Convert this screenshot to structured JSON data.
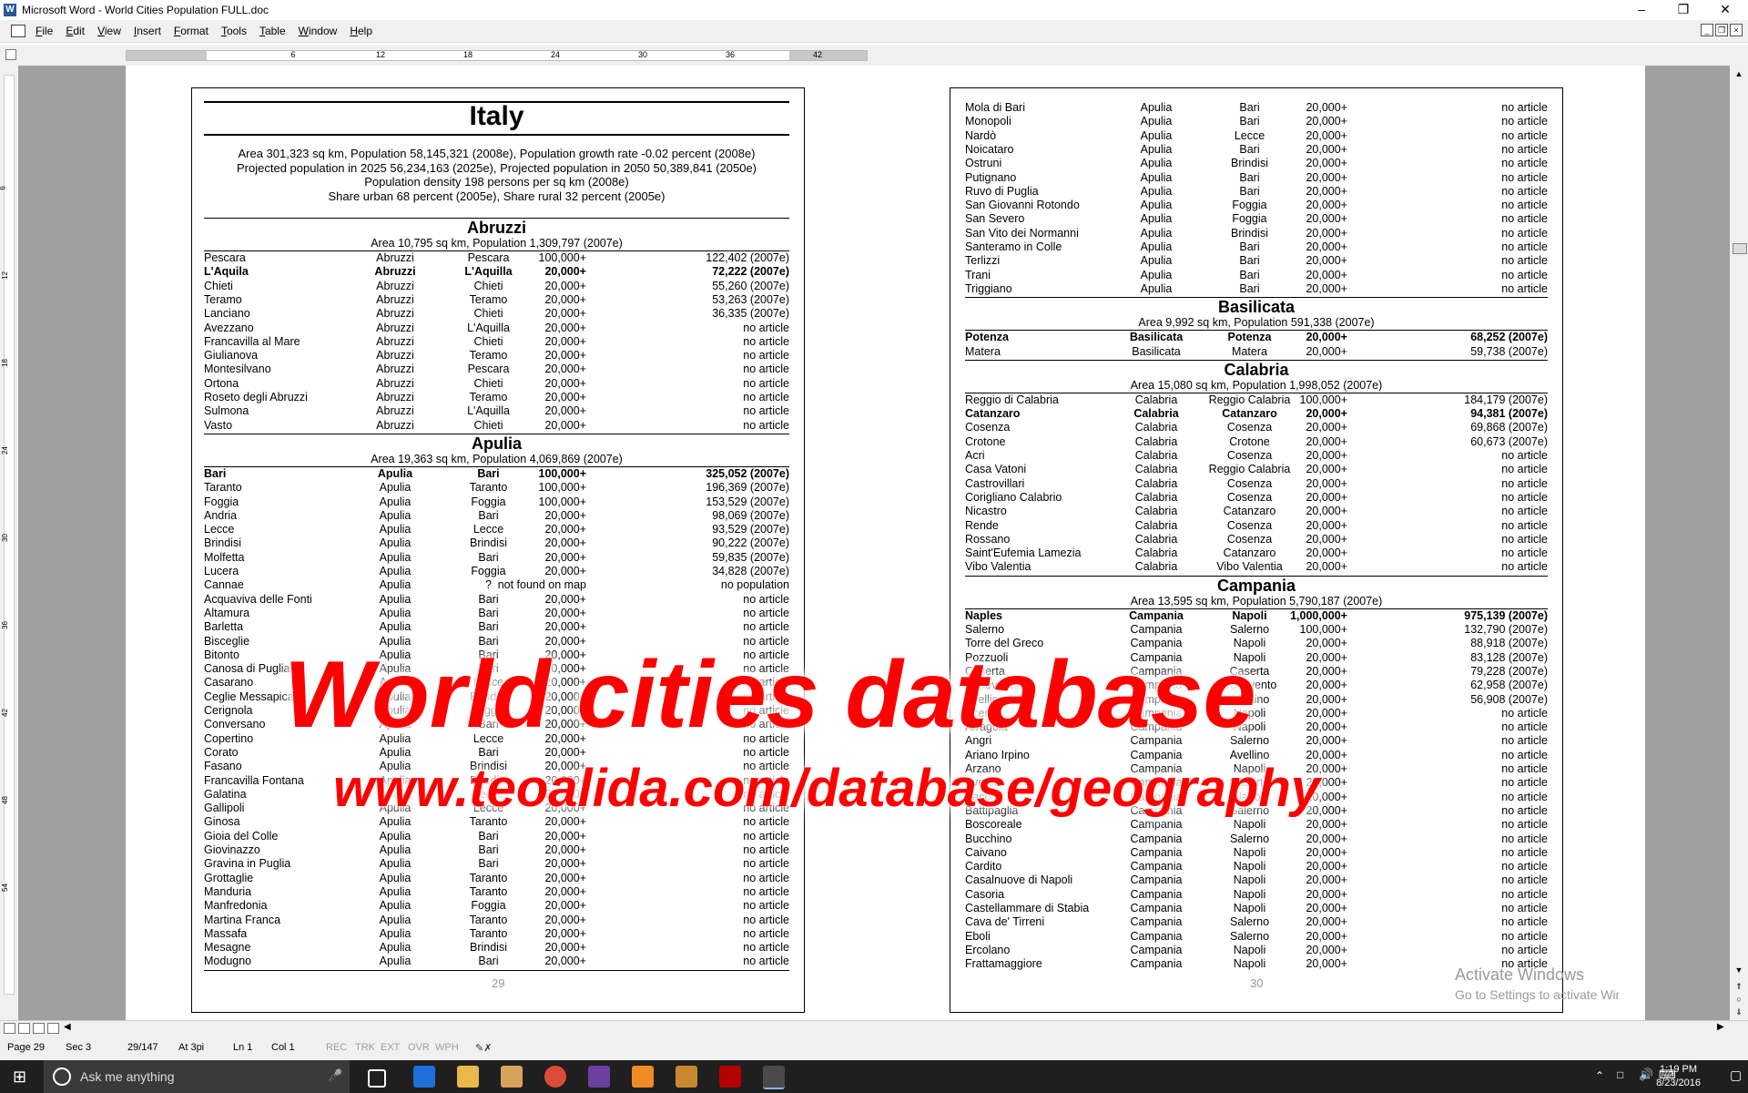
{
  "window": {
    "title": "Microsoft Word - World Cities Population FULL.doc"
  },
  "menu": [
    "File",
    "Edit",
    "View",
    "Insert",
    "Format",
    "Tools",
    "Table",
    "Window",
    "Help"
  ],
  "ruler": {
    "h_numbers": [
      "6",
      "12",
      "18",
      "24",
      "30",
      "36",
      "42"
    ],
    "v_numbers": [
      "6",
      "12",
      "18",
      "24",
      "30",
      "36",
      "42",
      "48",
      "54"
    ]
  },
  "left_page": {
    "country": "Italy",
    "intro": [
      "Area 301,323 sq km, Population 58,145,321 (2008e), Population growth rate -0.02 percent (2008e)",
      "Projected population in 2025 56,234,163 (2025e), Projected population in 2050 50,389,841 (2050e)",
      "Population density 198 persons per sq km (2008e)",
      "Share urban 68 percent (2005e), Share rural 32 percent (2005e)"
    ],
    "sections": [
      {
        "name": "Abruzzi",
        "subtitle": "Area 10,795 sq km, Population 1,309,797 (2007e)",
        "rows": [
          [
            "Pescara",
            "Abruzzi",
            "Pescara",
            "100,000+",
            "122,402 (2007e)",
            0
          ],
          [
            "L'Aquila",
            "Abruzzi",
            "L'Aquilla",
            "20,000+",
            "72,222 (2007e)",
            1
          ],
          [
            "Chieti",
            "Abruzzi",
            "Chieti",
            "20,000+",
            "55,260 (2007e)",
            0
          ],
          [
            "Teramo",
            "Abruzzi",
            "Teramo",
            "20,000+",
            "53,263 (2007e)",
            0
          ],
          [
            "Lanciano",
            "Abruzzi",
            "Chieti",
            "20,000+",
            "36,335 (2007e)",
            0
          ],
          [
            "Avezzano",
            "Abruzzi",
            "L'Aquilla",
            "20,000+",
            "no article",
            0
          ],
          [
            "Francavilla al Mare",
            "Abruzzi",
            "Chieti",
            "20,000+",
            "no article",
            0
          ],
          [
            "Giulianova",
            "Abruzzi",
            "Teramo",
            "20,000+",
            "no article",
            0
          ],
          [
            "Montesilvano",
            "Abruzzi",
            "Pescara",
            "20,000+",
            "no article",
            0
          ],
          [
            "Ortona",
            "Abruzzi",
            "Chieti",
            "20,000+",
            "no article",
            0
          ],
          [
            "Roseto degli Abruzzi",
            "Abruzzi",
            "Teramo",
            "20,000+",
            "no article",
            0
          ],
          [
            "Sulmona",
            "Abruzzi",
            "L'Aquilla",
            "20,000+",
            "no article",
            0
          ],
          [
            "Vasto",
            "Abruzzi",
            "Chieti",
            "20,000+",
            "no article",
            0
          ]
        ]
      },
      {
        "name": "Apulia",
        "subtitle": "Area 19,363 sq km, Population 4,069,869 (2007e)",
        "rows": [
          [
            "Bari",
            "Apulia",
            "Bari",
            "100,000+",
            "325,052 (2007e)",
            1
          ],
          [
            "Taranto",
            "Apulia",
            "Taranto",
            "100,000+",
            "196,369 (2007e)",
            0
          ],
          [
            "Foggia",
            "Apulia",
            "Foggia",
            "100,000+",
            "153,529 (2007e)",
            0
          ],
          [
            "Andria",
            "Apulia",
            "Bari",
            "20,000+",
            "98,069 (2007e)",
            0
          ],
          [
            "Lecce",
            "Apulia",
            "Lecce",
            "20,000+",
            "93,529 (2007e)",
            0
          ],
          [
            "Brindisi",
            "Apulia",
            "Brindisi",
            "20,000+",
            "90,222 (2007e)",
            0
          ],
          [
            "Molfetta",
            "Apulia",
            "Bari",
            "20,000+",
            "59,835 (2007e)",
            0
          ],
          [
            "Lucera",
            "Apulia",
            "Foggia",
            "20,000+",
            "34,828 (2007e)",
            0
          ],
          [
            "Cannae",
            "Apulia",
            "?",
            "not found on map",
            "no population",
            0
          ],
          [
            "Acquaviva delle Fonti",
            "Apulia",
            "Bari",
            "20,000+",
            "no article",
            0
          ],
          [
            "Altamura",
            "Apulia",
            "Bari",
            "20,000+",
            "no article",
            0
          ],
          [
            "Barletta",
            "Apulia",
            "Bari",
            "20,000+",
            "no article",
            0
          ],
          [
            "Bisceglie",
            "Apulia",
            "Bari",
            "20,000+",
            "no article",
            0
          ],
          [
            "Bitonto",
            "Apulia",
            "Bari",
            "20,000+",
            "no article",
            0
          ],
          [
            "Canosa di Puglia",
            "Apulia",
            "Bari",
            "20,000+",
            "no article",
            0
          ],
          [
            "Casarano",
            "Apulia",
            "Lecce",
            "20,000+",
            "no article",
            0
          ],
          [
            "Ceglie Messapica",
            "Apulia",
            "Brindisi",
            "20,000+",
            "no article",
            0
          ],
          [
            "Cerignola",
            "Apulia",
            "Foggia",
            "20,000+",
            "no article",
            0
          ],
          [
            "Conversano",
            "Apulia",
            "Bari",
            "20,000+",
            "no article",
            0
          ],
          [
            "Copertino",
            "Apulia",
            "Lecce",
            "20,000+",
            "no article",
            0
          ],
          [
            "Corato",
            "Apulia",
            "Bari",
            "20,000+",
            "no article",
            0
          ],
          [
            "Fasano",
            "Apulia",
            "Brindisi",
            "20,000+",
            "no article",
            0
          ],
          [
            "Francavilla Fontana",
            "Apulia",
            "Brindisi",
            "20,000+",
            "no article",
            0
          ],
          [
            "Galatina",
            "Apulia",
            "Lecce",
            "20,000+",
            "no article",
            0
          ],
          [
            "Gallipoli",
            "Apulia",
            "Lecce",
            "20,000+",
            "no article",
            0
          ],
          [
            "Ginosa",
            "Apulia",
            "Taranto",
            "20,000+",
            "no article",
            0
          ],
          [
            "Gioia del Colle",
            "Apulia",
            "Bari",
            "20,000+",
            "no article",
            0
          ],
          [
            "Giovinazzo",
            "Apulia",
            "Bari",
            "20,000+",
            "no article",
            0
          ],
          [
            "Gravina in Puglia",
            "Apulia",
            "Bari",
            "20,000+",
            "no article",
            0
          ],
          [
            "Grottaglie",
            "Apulia",
            "Taranto",
            "20,000+",
            "no article",
            0
          ],
          [
            "Manduria",
            "Apulia",
            "Taranto",
            "20,000+",
            "no article",
            0
          ],
          [
            "Manfredonia",
            "Apulia",
            "Foggia",
            "20,000+",
            "no article",
            0
          ],
          [
            "Martina Franca",
            "Apulia",
            "Taranto",
            "20,000+",
            "no article",
            0
          ],
          [
            "Massafa",
            "Apulia",
            "Taranto",
            "20,000+",
            "no article",
            0
          ],
          [
            "Mesagne",
            "Apulia",
            "Brindisi",
            "20,000+",
            "no article",
            0
          ],
          [
            "Modugno",
            "Apulia",
            "Bari",
            "20,000+",
            "no article",
            0
          ]
        ]
      }
    ],
    "page_number": "29"
  },
  "right_page": {
    "sections": [
      {
        "name": "",
        "subtitle": "",
        "rows": [
          [
            "Mola di Bari",
            "Apulia",
            "Bari",
            "20,000+",
            "no article",
            0
          ],
          [
            "Monopoli",
            "Apulia",
            "Bari",
            "20,000+",
            "no article",
            0
          ],
          [
            "Nardò",
            "Apulia",
            "Lecce",
            "20,000+",
            "no article",
            0
          ],
          [
            "Noicataro",
            "Apulia",
            "Bari",
            "20,000+",
            "no article",
            0
          ],
          [
            "Ostruni",
            "Apulia",
            "Brindisi",
            "20,000+",
            "no article",
            0
          ],
          [
            "Putignano",
            "Apulia",
            "Bari",
            "20,000+",
            "no article",
            0
          ],
          [
            "Ruvo di Puglia",
            "Apulia",
            "Bari",
            "20,000+",
            "no article",
            0
          ],
          [
            "San Giovanni Rotondo",
            "Apulia",
            "Foggia",
            "20,000+",
            "no article",
            0
          ],
          [
            "San Severo",
            "Apulia",
            "Foggia",
            "20,000+",
            "no article",
            0
          ],
          [
            "San Vito dei Normanni",
            "Apulia",
            "Brindisi",
            "20,000+",
            "no article",
            0
          ],
          [
            "Santeramo in Colle",
            "Apulia",
            "Bari",
            "20,000+",
            "no article",
            0
          ],
          [
            "Terlizzi",
            "Apulia",
            "Bari",
            "20,000+",
            "no article",
            0
          ],
          [
            "Trani",
            "Apulia",
            "Bari",
            "20,000+",
            "no article",
            0
          ],
          [
            "Triggiano",
            "Apulia",
            "Bari",
            "20,000+",
            "no article",
            0
          ]
        ]
      },
      {
        "name": "Basilicata",
        "subtitle": "Area 9,992 sq km, Population 591,338 (2007e)",
        "rows": [
          [
            "Potenza",
            "Basilicata",
            "Potenza",
            "20,000+",
            "68,252 (2007e)",
            1
          ],
          [
            "Matera",
            "Basilicata",
            "Matera",
            "20,000+",
            "59,738 (2007e)",
            0
          ]
        ]
      },
      {
        "name": "Calabria",
        "subtitle": "Area 15,080 sq km, Population 1,998,052 (2007e)",
        "rows": [
          [
            "Reggio di Calabria",
            "Calabria",
            "Reggio Calabria",
            "100,000+",
            "184,179 (2007e)",
            0
          ],
          [
            "Catanzaro",
            "Calabria",
            "Catanzaro",
            "20,000+",
            "94,381 (2007e)",
            1
          ],
          [
            "Cosenza",
            "Calabria",
            "Cosenza",
            "20,000+",
            "69,868 (2007e)",
            0
          ],
          [
            "Crotone",
            "Calabria",
            "Crotone",
            "20,000+",
            "60,673 (2007e)",
            0
          ],
          [
            "Acri",
            "Calabria",
            "Cosenza",
            "20,000+",
            "no article",
            0
          ],
          [
            "Casa Vatoni",
            "Calabria",
            "Reggio Calabria",
            "20,000+",
            "no article",
            0
          ],
          [
            "Castrovillari",
            "Calabria",
            "Cosenza",
            "20,000+",
            "no article",
            0
          ],
          [
            "Corigliano Calabrio",
            "Calabria",
            "Cosenza",
            "20,000+",
            "no article",
            0
          ],
          [
            "Nicastro",
            "Calabria",
            "Catanzaro",
            "20,000+",
            "no article",
            0
          ],
          [
            "Rende",
            "Calabria",
            "Cosenza",
            "20,000+",
            "no article",
            0
          ],
          [
            "Rossano",
            "Calabria",
            "Cosenza",
            "20,000+",
            "no article",
            0
          ],
          [
            "Saint'Eufemia Lamezia",
            "Calabria",
            "Catanzaro",
            "20,000+",
            "no article",
            0
          ],
          [
            "Vibo Valentia",
            "Calabria",
            "Vibo Valentia",
            "20,000+",
            "no article",
            0
          ]
        ]
      },
      {
        "name": "Campania",
        "subtitle": "Area 13,595 sq km, Population 5,790,187 (2007e)",
        "rows": [
          [
            "Naples",
            "Campania",
            "Napoli",
            "1,000,000+",
            "975,139 (2007e)",
            1
          ],
          [
            "Salerno",
            "Campania",
            "Salerno",
            "100,000+",
            "132,790 (2007e)",
            0
          ],
          [
            "Torre del Greco",
            "Campania",
            "Napoli",
            "20,000+",
            "88,918 (2007e)",
            0
          ],
          [
            "Pozzuoli",
            "Campania",
            "Napoli",
            "20,000+",
            "83,128 (2007e)",
            0
          ],
          [
            "Caserta",
            "Campania",
            "Caserta",
            "20,000+",
            "79,228 (2007e)",
            0
          ],
          [
            "Benevento",
            "Campania",
            "Benevento",
            "20,000+",
            "62,958 (2007e)",
            0
          ],
          [
            "Avellino",
            "Campania",
            "Avellino",
            "20,000+",
            "56,908 (2007e)",
            0
          ],
          [
            "Acerra",
            "Campania",
            "Napoli",
            "20,000+",
            "no article",
            0
          ],
          [
            "Afragola",
            "Campania",
            "Napoli",
            "20,000+",
            "no article",
            0
          ],
          [
            "Angri",
            "Campania",
            "Salerno",
            "20,000+",
            "no article",
            0
          ],
          [
            "Ariano Irpino",
            "Campania",
            "Avellino",
            "20,000+",
            "no article",
            0
          ],
          [
            "Arzano",
            "Campania",
            "Napoli",
            "20,000+",
            "no article",
            0
          ],
          [
            "Aversa",
            "Campania",
            "Caserta",
            "20,000+",
            "no article",
            0
          ],
          [
            "Bacoli",
            "Campania",
            "Napoli",
            "20,000+",
            "no article",
            0
          ],
          [
            "Battipaglia",
            "Campania",
            "Salerno",
            "20,000+",
            "no article",
            0
          ],
          [
            "Boscoreale",
            "Campania",
            "Napoli",
            "20,000+",
            "no article",
            0
          ],
          [
            "Bucchino",
            "Campania",
            "Salerno",
            "20,000+",
            "no article",
            0
          ],
          [
            "Caivano",
            "Campania",
            "Napoli",
            "20,000+",
            "no article",
            0
          ],
          [
            "Cardito",
            "Campania",
            "Napoli",
            "20,000+",
            "no article",
            0
          ],
          [
            "Casalnuove di Napoli",
            "Campania",
            "Napoli",
            "20,000+",
            "no article",
            0
          ],
          [
            "Casoria",
            "Campania",
            "Napoli",
            "20,000+",
            "no article",
            0
          ],
          [
            "Castellammare di Stabia",
            "Campania",
            "Napoli",
            "20,000+",
            "no article",
            0
          ],
          [
            "Cava de' Tirreni",
            "Campania",
            "Salerno",
            "20,000+",
            "no article",
            0
          ],
          [
            "Eboli",
            "Campania",
            "Salerno",
            "20,000+",
            "no article",
            0
          ],
          [
            "Ercolano",
            "Campania",
            "Napoli",
            "20,000+",
            "no article",
            0
          ],
          [
            "Frattamaggiore",
            "Campania",
            "Napoli",
            "20,000+",
            "no article",
            0
          ]
        ]
      }
    ],
    "page_number": "30"
  },
  "watermark": {
    "line1": "World cities database",
    "line2": "www.teoalida.com/database/geography"
  },
  "activate": {
    "line1": "Activate Windows",
    "line2": "Go to Settings to activate Windows."
  },
  "status": {
    "page": "Page 29",
    "sec": "Sec 3",
    "pages": "29/147",
    "at": "At 3pi",
    "ln": "Ln 1",
    "col": "Col 1",
    "rec": "REC",
    "trk": "TRK",
    "ext": "EXT",
    "ovr": "OVR",
    "wph": "WPH"
  },
  "taskbar": {
    "search_placeholder": "Ask me anything",
    "time": "1:19 PM",
    "date": "8/23/2016"
  }
}
